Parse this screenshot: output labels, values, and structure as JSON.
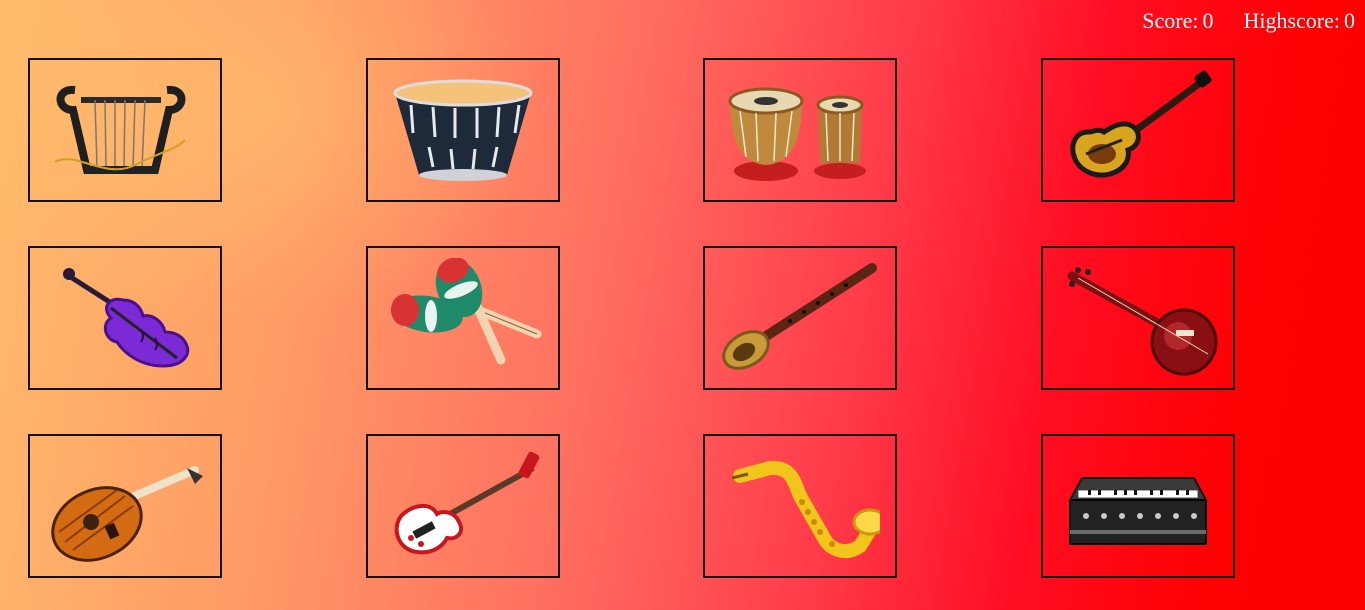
{
  "header": {
    "score_label": "Score:",
    "score_value": "0",
    "highscore_label": "Highscore:",
    "highscore_value": "0"
  },
  "cards": [
    {
      "icon": "lyre-icon"
    },
    {
      "icon": "drum-icon"
    },
    {
      "icon": "tabla-icon"
    },
    {
      "icon": "guitar-icon"
    },
    {
      "icon": "violin-icon"
    },
    {
      "icon": "maracas-icon"
    },
    {
      "icon": "shehnai-icon"
    },
    {
      "icon": "sitar-icon"
    },
    {
      "icon": "oud-icon"
    },
    {
      "icon": "bass-guitar-icon"
    },
    {
      "icon": "saxophone-icon"
    },
    {
      "icon": "harmonium-icon"
    }
  ]
}
